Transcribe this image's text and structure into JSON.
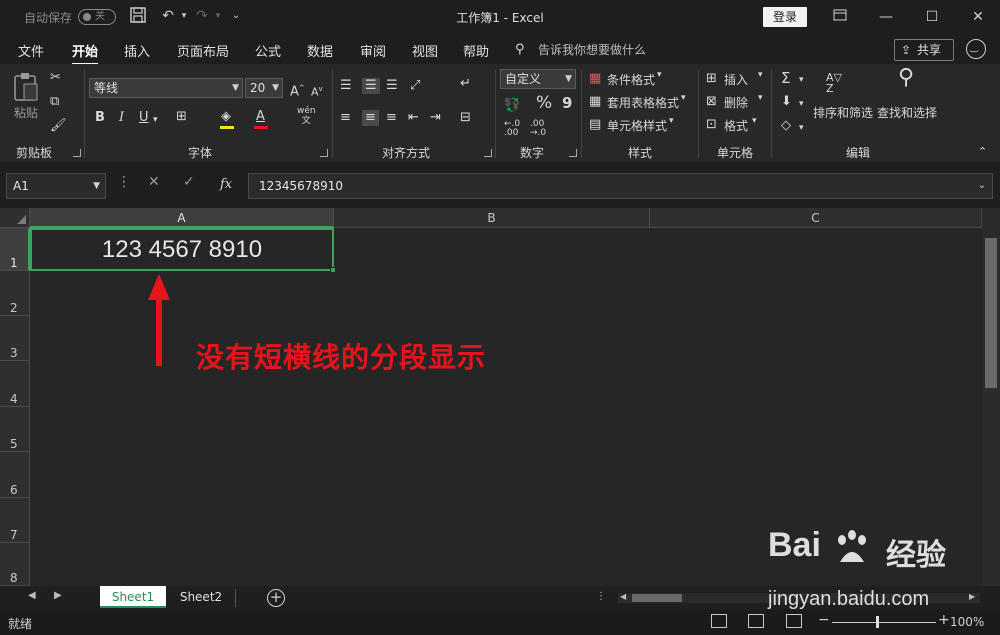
{
  "titlebar": {
    "autosave_label": "自动保存",
    "autosave_state": "关",
    "title": "工作簿1  -  Excel",
    "login_label": "登录"
  },
  "tabs": [
    "文件",
    "开始",
    "插入",
    "页面布局",
    "公式",
    "数据",
    "审阅",
    "视图",
    "帮助"
  ],
  "active_tab": "开始",
  "tellme": "告诉我你想要做什么",
  "share_label": "共享",
  "ribbon": {
    "clipboard": {
      "paste": "粘贴",
      "group": "剪贴板"
    },
    "font": {
      "name": "等线",
      "size": "20",
      "group": "字体",
      "bold": "B",
      "italic": "I",
      "underline": "U",
      "wen": "wén\n文"
    },
    "alignment": {
      "group": "对齐方式"
    },
    "number": {
      "format": "自定义",
      "group": "数字",
      "percent": "%",
      "comma": "9"
    },
    "styles": {
      "conditional": "条件格式",
      "table": "套用表格格式",
      "cell": "单元格样式",
      "group": "样式"
    },
    "cells": {
      "insert": "插入",
      "delete": "删除",
      "format": "格式",
      "group": "单元格"
    },
    "editing": {
      "sort": "排序和筛选",
      "find": "查找和选择",
      "group": "编辑"
    }
  },
  "formula_bar": {
    "name_box": "A1",
    "fx": "fx",
    "content": "12345678910"
  },
  "columns": [
    "A",
    "B",
    "C"
  ],
  "rows": [
    "1",
    "2",
    "3",
    "4",
    "5",
    "6",
    "7",
    "8"
  ],
  "cell_A1": "123 4567 8910",
  "annotation": "没有短横线的分段显示",
  "sheets": [
    "Sheet1",
    "Sheet2"
  ],
  "active_sheet": "Sheet1",
  "status": "就绪",
  "zoom": "100%",
  "watermark": {
    "logo": "Bai du",
    "cn": "经验",
    "url": "jingyan.baidu.com"
  },
  "colors": {
    "accent": "#3ea35f",
    "annotation": "#e8141b",
    "background": "#262626"
  }
}
